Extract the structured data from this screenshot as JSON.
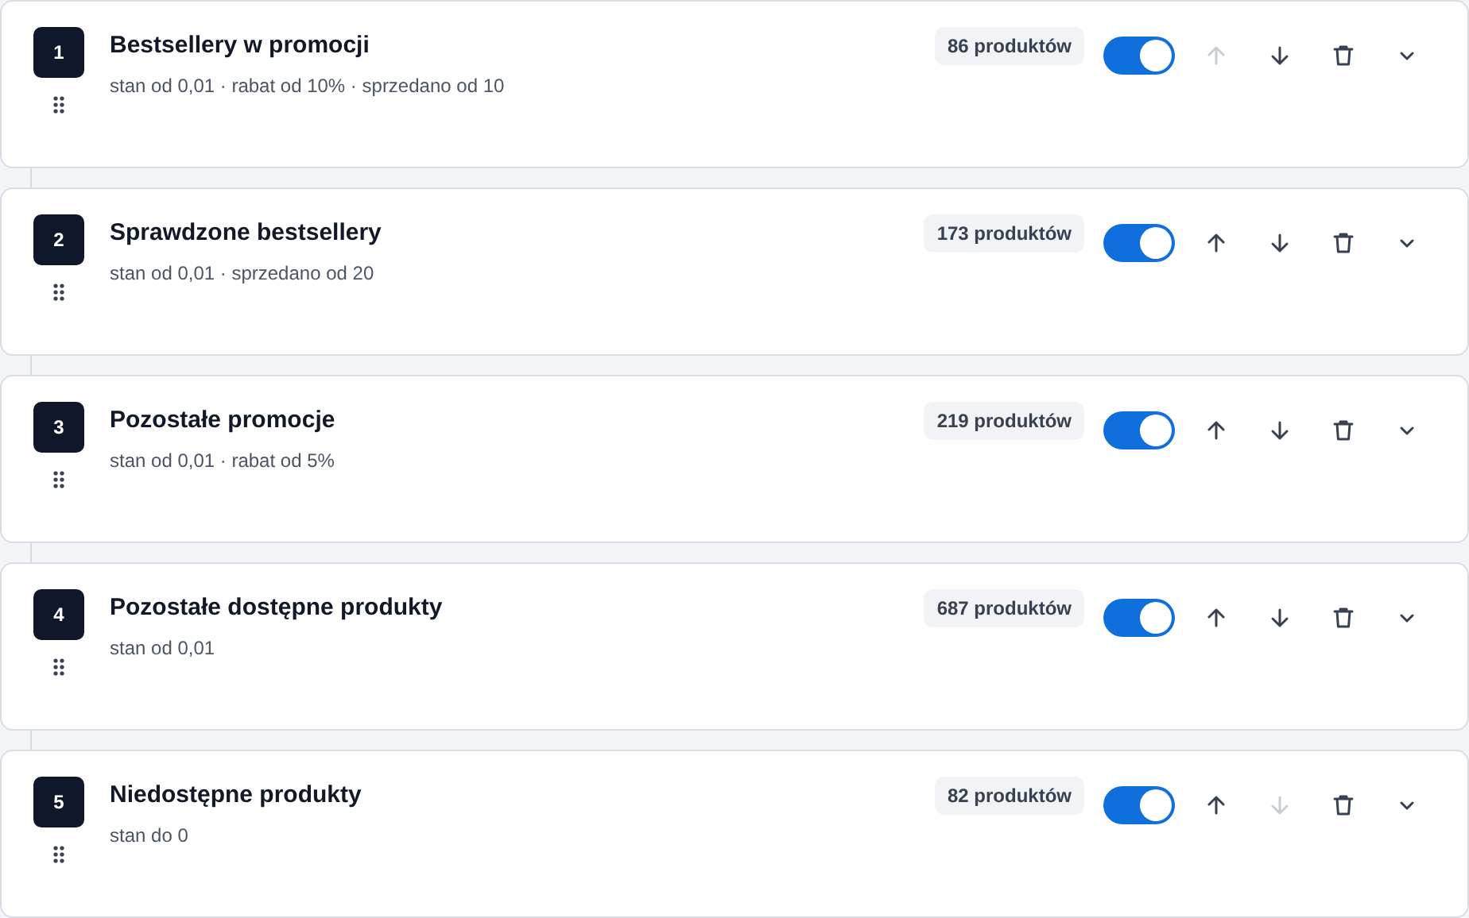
{
  "rules": [
    {
      "number": "1",
      "title": "Bestsellery w promocji",
      "conditions": "stan od 0,01 · rabat od 10% · sprzedano od 10",
      "count": "86 produktów",
      "on": true,
      "up_disabled": true,
      "down_disabled": false,
      "expanded": false
    },
    {
      "number": "2",
      "title": "Sprawdzone bestsellery",
      "conditions": "stan od 0,01 · sprzedano od 20",
      "count": "173 produktów",
      "on": true,
      "up_disabled": false,
      "down_disabled": false,
      "expanded": false
    },
    {
      "number": "3",
      "title": "Pozostałe promocje",
      "conditions": "stan od 0,01 · rabat od 5%",
      "count": "219 produktów",
      "on": true,
      "up_disabled": false,
      "down_disabled": false,
      "expanded": false
    },
    {
      "number": "4",
      "title": "Pozostałe dostępne produkty",
      "conditions": "stan od 0,01",
      "count": "687 produktów",
      "on": true,
      "up_disabled": false,
      "down_disabled": false,
      "expanded": false
    },
    {
      "number": "5",
      "title": "Niedostępne produkty",
      "conditions": "stan do 0",
      "count": "82 produktów",
      "on": true,
      "up_disabled": false,
      "down_disabled": true,
      "expanded": false
    }
  ]
}
